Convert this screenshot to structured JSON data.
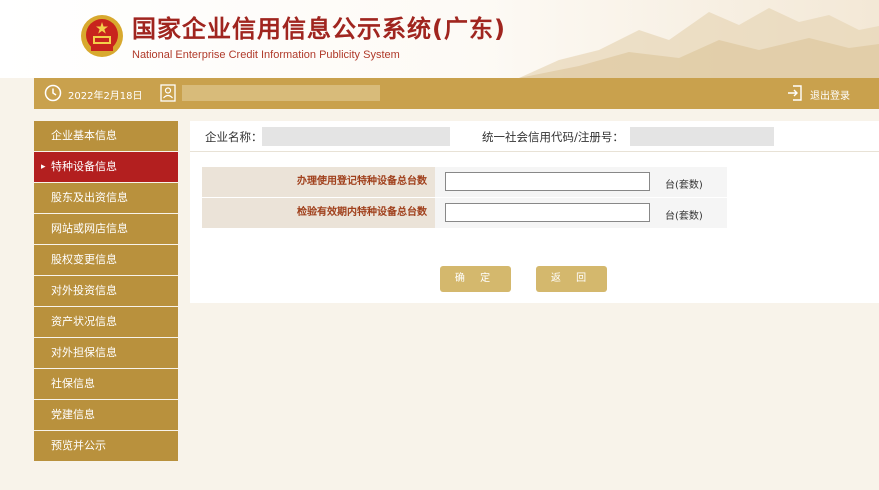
{
  "header": {
    "title_cn": "国家企业信用信息公示系统(广东)",
    "title_en": "National Enterprise Credit Information Publicity System"
  },
  "toolbar": {
    "date": "2022年2月18日",
    "logout_label": "退出登录"
  },
  "sidebar": {
    "items": [
      {
        "label": "企业基本信息"
      },
      {
        "label": "特种设备信息"
      },
      {
        "label": "股东及出资信息"
      },
      {
        "label": "网站或网店信息"
      },
      {
        "label": "股权变更信息"
      },
      {
        "label": "对外投资信息"
      },
      {
        "label": "资产状况信息"
      },
      {
        "label": "对外担保信息"
      },
      {
        "label": "社保信息"
      },
      {
        "label": "党建信息"
      },
      {
        "label": "预览并公示"
      }
    ],
    "active_index": 1
  },
  "info": {
    "name_label": "企业名称：",
    "code_label": "统一社会信用代码/注册号："
  },
  "form": {
    "rows": [
      {
        "label": "办理使用登记特种设备总台数",
        "value": "",
        "unit": "台(套数)"
      },
      {
        "label": "检验有效期内特种设备总台数",
        "value": "",
        "unit": "台(套数)"
      }
    ]
  },
  "buttons": {
    "confirm": "确 定",
    "back": "返 回"
  },
  "colors": {
    "gold": "#c9a14d",
    "nav": "#b9913d",
    "active": "#b31f1f",
    "title": "#a0251f"
  }
}
